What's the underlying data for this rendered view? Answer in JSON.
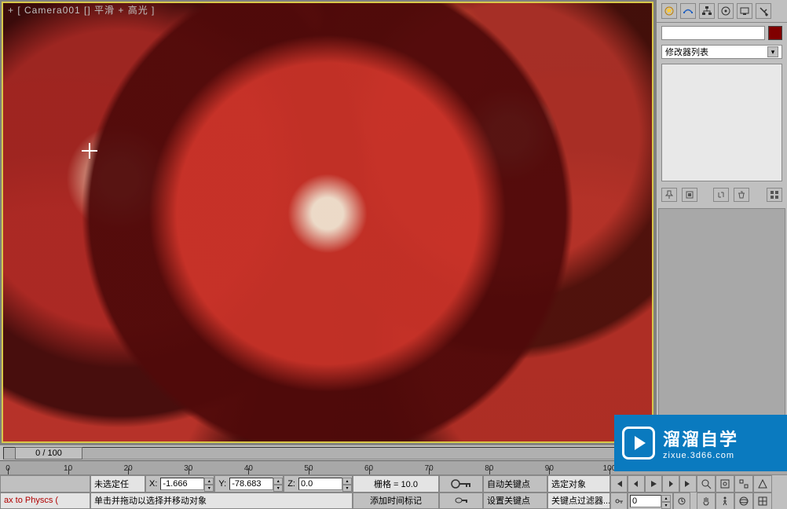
{
  "viewport": {
    "label": "+ [ Camera001 [] 平滑 + 高光 ]"
  },
  "right_panel": {
    "modifier_list_label": "修改器列表",
    "object_color": "#800000"
  },
  "timeline": {
    "slider_label": "0 / 100",
    "ticks": [
      0,
      10,
      20,
      30,
      40,
      50,
      60,
      70,
      80,
      90,
      100
    ],
    "current_frame": "0"
  },
  "status": {
    "script_listener": "ax to Physcs (",
    "selection_label": "未选定任",
    "prompt": "单击并拖动以选择并移动对象",
    "coords": {
      "x_label": "X:",
      "x": "-1.666",
      "y_label": "Y:",
      "y": "-78.683",
      "z_label": "Z:",
      "z": "0.0"
    },
    "grid": "栅格 = 10.0",
    "add_time_tag": "添加时间标记",
    "auto_key": "自动关键点",
    "set_key": "设置关键点",
    "selection_lock": "选定对象",
    "key_filters": "关键点过滤器..."
  },
  "watermark": {
    "brand": "溜溜自学",
    "url": "zixue.3d66.com"
  }
}
